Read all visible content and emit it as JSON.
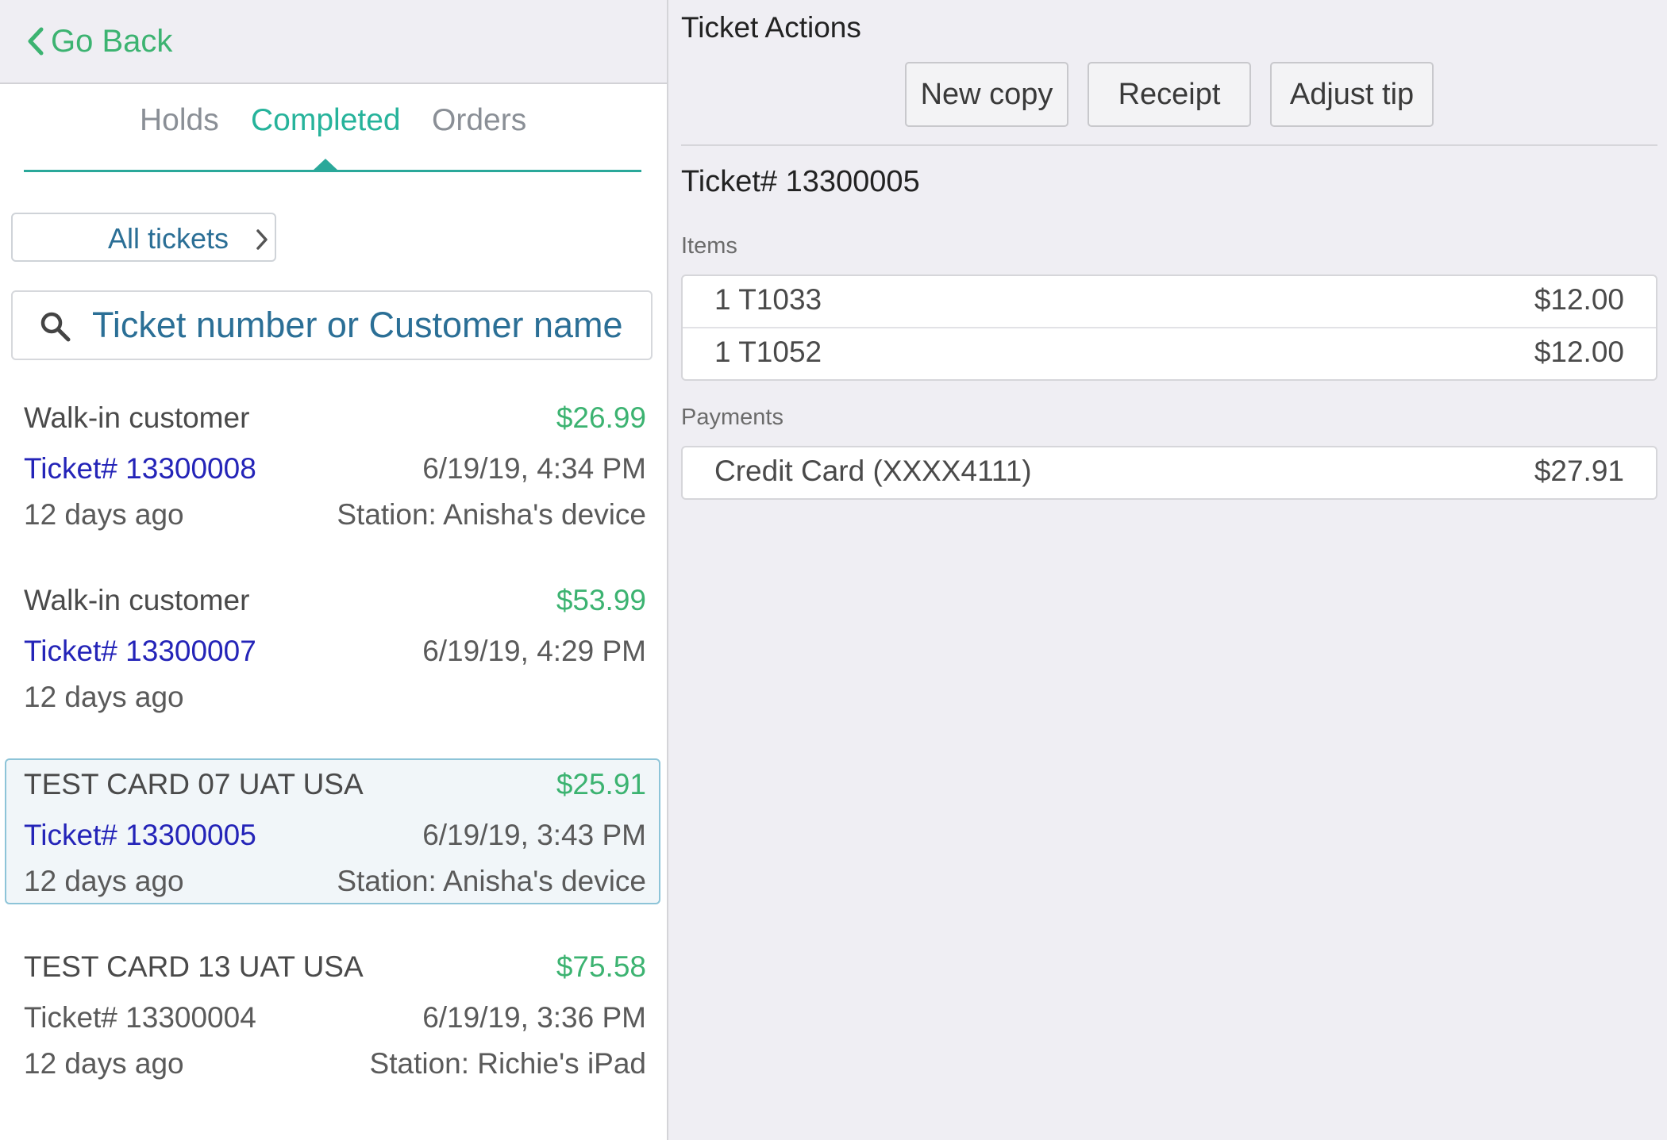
{
  "nav": {
    "back_label": "Go Back"
  },
  "tabs": [
    {
      "label": "Holds",
      "active": false
    },
    {
      "label": "Completed",
      "active": true
    },
    {
      "label": "Orders",
      "active": false
    }
  ],
  "filter": {
    "label": "All tickets"
  },
  "search": {
    "placeholder": "Ticket number or Customer name",
    "value": ""
  },
  "tickets": [
    {
      "customer": "Walk-in customer",
      "amount": "$26.99",
      "number": "Ticket# 13300008",
      "datetime": "6/19/19, 4:34 PM",
      "age": "12 days ago",
      "station": "Station: Anisha's device",
      "selected": false
    },
    {
      "customer": "Walk-in customer",
      "amount": "$53.99",
      "number": "Ticket# 13300007",
      "datetime": "6/19/19, 4:29 PM",
      "age": "12 days ago",
      "station": "",
      "selected": false
    },
    {
      "customer": "TEST CARD 07 UAT USA",
      "amount": "$25.91",
      "number": "Ticket# 13300005",
      "datetime": "6/19/19, 3:43 PM",
      "age": "12 days ago",
      "station": "Station: Anisha's device",
      "selected": true
    },
    {
      "customer": "TEST CARD 13 UAT USA",
      "amount": "$75.58",
      "number": "Ticket# 13300004",
      "datetime": "6/19/19, 3:36 PM",
      "age": "12 days ago",
      "station": "Station: Richie's iPad",
      "selected": false
    }
  ],
  "detail": {
    "actions_title": "Ticket Actions",
    "actions": [
      "New copy",
      "Receipt",
      "Adjust tip"
    ],
    "ticket_title": "Ticket# 13300005",
    "items_label": "Items",
    "items": [
      {
        "desc": "1 T1033",
        "price": "$12.00"
      },
      {
        "desc": "1 T1052",
        "price": "$12.00"
      }
    ],
    "payments_label": "Payments",
    "payments": [
      {
        "method": "Credit Card (XXXX4111)",
        "amount": "$27.91"
      }
    ]
  },
  "colors": {
    "accent_green": "#3cb371",
    "tab_active": "#26b39b",
    "link_blue": "#2424b8",
    "filter_blue": "#2b6f96"
  },
  "icons": [
    "chevron-left-icon",
    "chevron-right-icon",
    "search-icon"
  ]
}
